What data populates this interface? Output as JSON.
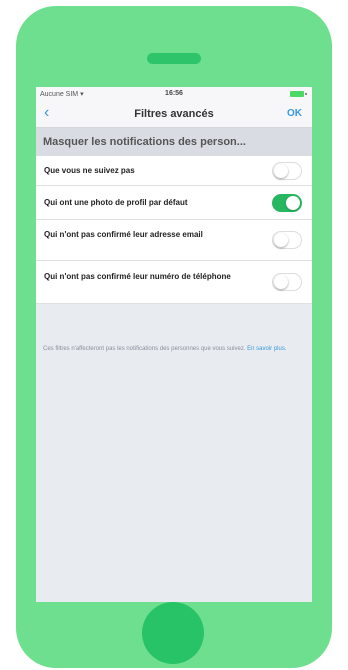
{
  "status_bar": {
    "carrier": "Aucune SIM ▾",
    "time": "16:56"
  },
  "navbar": {
    "back_icon": "‹",
    "title": "Filtres avancés",
    "ok_label": "OK"
  },
  "section": {
    "header": "Masquer les notifications des person..."
  },
  "rows": [
    {
      "label": "Que vous ne suivez pas",
      "enabled": false
    },
    {
      "label": "Qui ont une photo de profil par défaut",
      "enabled": true
    },
    {
      "label": "Qui n'ont pas confirmé leur adresse email",
      "enabled": false
    },
    {
      "label": "Qui n'ont pas confirmé leur numéro de téléphone",
      "enabled": false
    }
  ],
  "footer": {
    "note": "Ces filtres n'affecteront pas les notifications des personnes que vous suivez.",
    "link": "En savoir plus."
  },
  "colors": {
    "phone_body": "#6ede8f",
    "accent": "#3a9ad9",
    "toggle_on": "#28b761"
  }
}
